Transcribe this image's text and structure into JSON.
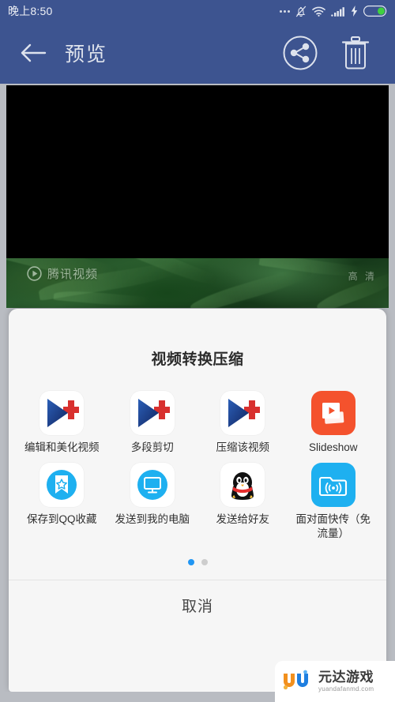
{
  "statusbar": {
    "time": "晚上8:50",
    "icons": [
      "more-dots-icon",
      "silent-bell-icon",
      "wifi-icon",
      "signal-bars-icon",
      "charging-bolt-icon",
      "battery-icon"
    ]
  },
  "appbar": {
    "back_icon": "back-arrow-icon",
    "title": "预览",
    "share_icon": "share-icon",
    "delete_icon": "trash-icon"
  },
  "video": {
    "watermark_text": "腾讯视频",
    "play_icon": "play-icon",
    "quality_badge": "高 清"
  },
  "sheet": {
    "title": "视频转换压缩",
    "cancel_label": "取消",
    "page_dots": {
      "count": 2,
      "active_index": 0
    },
    "items": [
      {
        "label": "编辑和美化视频",
        "icon": "videoshow-app-icon",
        "style": "white"
      },
      {
        "label": "多段剪切",
        "icon": "videoshow-app-icon",
        "style": "white"
      },
      {
        "label": "压缩该视频",
        "icon": "videoshow-app-icon",
        "style": "white"
      },
      {
        "label": "Slideshow",
        "icon": "slideshow-icon",
        "style": "orange"
      },
      {
        "label": "保存到QQ收藏",
        "icon": "qq-favorite-star-icon",
        "style": "white"
      },
      {
        "label": "发送到我的电脑",
        "icon": "my-computer-monitor-icon",
        "style": "white"
      },
      {
        "label": "发送给好友",
        "icon": "qq-penguin-icon",
        "style": "white"
      },
      {
        "label": "面对面快传（免流量）",
        "icon": "face-to-face-transfer-icon",
        "style": "blue"
      }
    ]
  },
  "watermark": {
    "brand": "元达游戏",
    "domain": "yuandafanmd.com",
    "logo_icon": "yuanda-u-logo-icon"
  },
  "colors": {
    "appbar": "#3d5490",
    "accent_blue": "#1eb0f0",
    "accent_orange": "#f4522d",
    "sheet_bg": "#f6f6f6"
  }
}
